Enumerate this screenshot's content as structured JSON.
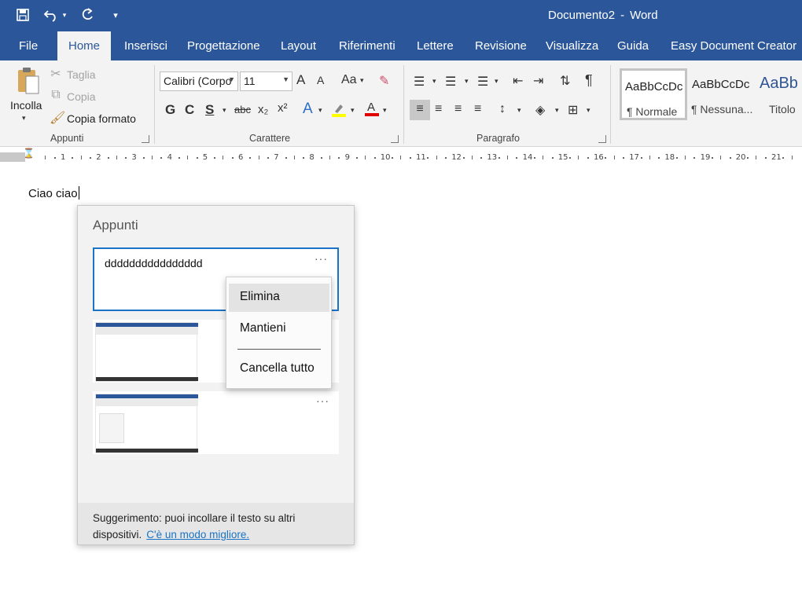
{
  "window": {
    "doc_name": "Documento2",
    "separator": "-",
    "app_name": "Word"
  },
  "qat": {
    "save_icon": "save-icon",
    "undo_icon": "undo-icon",
    "redo_icon": "redo-icon",
    "customize_icon": "customize-icon"
  },
  "tabs": [
    {
      "label": "File"
    },
    {
      "label": "Home"
    },
    {
      "label": "Inserisci"
    },
    {
      "label": "Progettazione"
    },
    {
      "label": "Layout"
    },
    {
      "label": "Riferimenti"
    },
    {
      "label": "Lettere"
    },
    {
      "label": "Revisione"
    },
    {
      "label": "Visualizza"
    },
    {
      "label": "Guida"
    },
    {
      "label": "Easy Document Creator"
    }
  ],
  "ribbon": {
    "clipboard": {
      "label": "Appunti",
      "paste": "Incolla",
      "cut": "Taglia",
      "copy": "Copia",
      "format_painter": "Copia formato"
    },
    "font": {
      "label": "Carattere",
      "font_name": "Calibri (Corpo",
      "font_size": "11",
      "bold": "G",
      "italic": "C",
      "underline": "S",
      "strike": "abc",
      "subscript": "x₂",
      "superscript": "x²",
      "grow": "A",
      "shrink": "A",
      "case": "Aa"
    },
    "paragraph": {
      "label": "Paragrafo"
    },
    "styles": [
      {
        "preview": "AaBbCcDc",
        "name": "¶ Normale"
      },
      {
        "preview": "AaBbCcDc",
        "name": "¶ Nessuna..."
      },
      {
        "preview": "AaBb",
        "name": "Titolo"
      }
    ]
  },
  "ruler": {
    "marks": [
      "1",
      "2",
      "3",
      "4",
      "5",
      "6",
      "7",
      "8",
      "9",
      "10",
      "11",
      "12",
      "13",
      "14",
      "15",
      "16",
      "17",
      "18",
      "19",
      "20",
      "21"
    ]
  },
  "document": {
    "text": "Ciao ciao"
  },
  "clipboard_panel": {
    "title": "Appunti",
    "items": [
      {
        "text": "dddddddddddddddd",
        "more": "···"
      },
      {
        "type": "image"
      },
      {
        "type": "image",
        "more": "···"
      }
    ],
    "footer_text": "Suggerimento: puoi incollare il testo su altri dispositivi.",
    "footer_link": "C'è un modo migliore."
  },
  "context_menu": {
    "items": [
      {
        "label": "Elimina"
      },
      {
        "label": "Mantieni"
      },
      {
        "label": "Cancella tutto"
      }
    ]
  },
  "colors": {
    "brand": "#2b579a",
    "accent": "#1a73c6",
    "highlight": "#ffff00",
    "font_color": "#e00000"
  }
}
